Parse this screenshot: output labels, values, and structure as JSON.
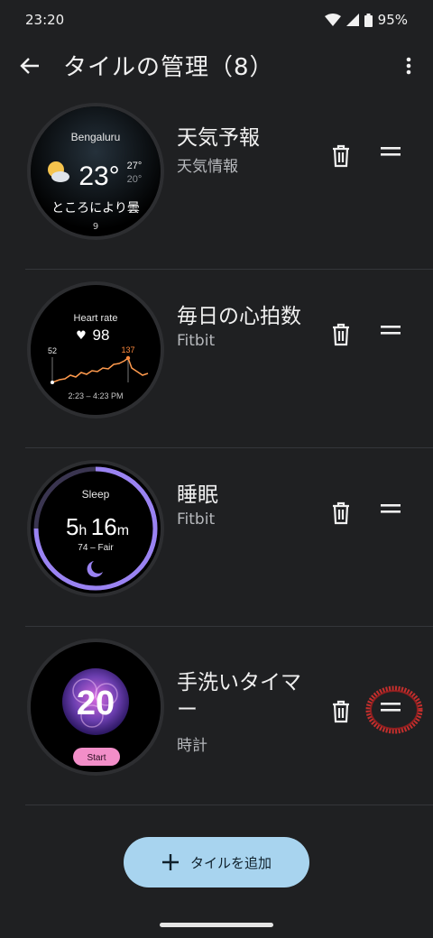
{
  "status": {
    "time": "23:20",
    "battery": "95%"
  },
  "header": {
    "title": "タイルの管理（8）"
  },
  "tiles": [
    {
      "name": "天気予報",
      "source": "天気情報",
      "preview": {
        "city": "Bengaluru",
        "temp": "23°",
        "high": "27°",
        "low": "20°",
        "condition": "ところにより曇"
      }
    },
    {
      "name": "毎日の心拍数",
      "source": "Fitbit",
      "preview": {
        "title": "Heart rate",
        "bpm": "98",
        "min": "52",
        "max": "137",
        "range": "2:23 – 4:23 PM"
      }
    },
    {
      "name": "睡眠",
      "source": "Fitbit",
      "preview": {
        "title": "Sleep",
        "hours": "5",
        "h_unit": "h",
        "minutes": "16",
        "m_unit": "m",
        "score": "74 – Fair"
      }
    },
    {
      "name": "手洗いタイマー",
      "source": "時計",
      "preview": {
        "count": "20",
        "button": "Start"
      }
    }
  ],
  "add_button": {
    "label": "タイルを追加"
  }
}
